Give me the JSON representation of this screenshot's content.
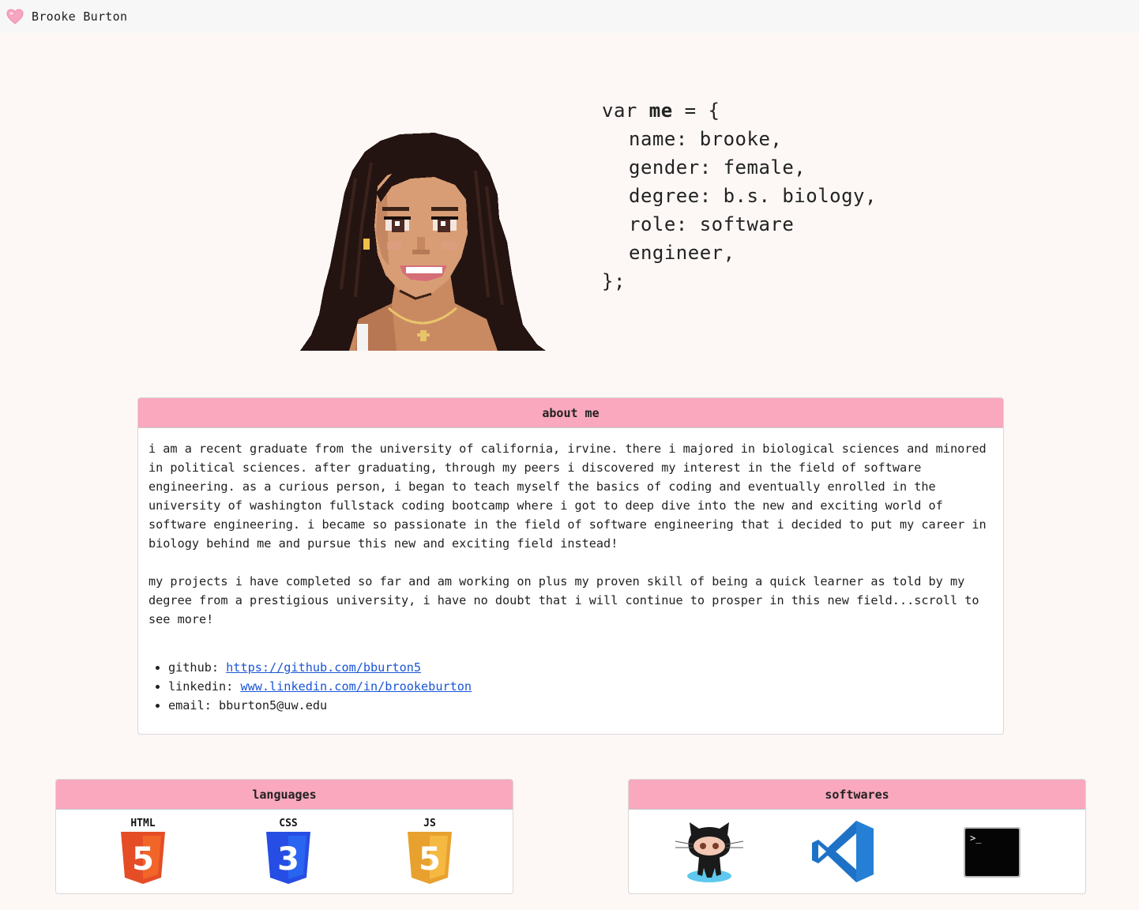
{
  "navbar": {
    "brand": "Brooke Burton",
    "logo_icon": "heart-icon"
  },
  "hero": {
    "avatar_icon": "pixel-portrait-avatar",
    "code": {
      "line1_prefix": "var ",
      "line1_var": "me",
      "line1_suffix": " = {",
      "name": "name: brooke,",
      "gender": "gender: female,",
      "degree": "degree: b.s. biology,",
      "role_line1": "role: software",
      "role_line2": "engineer,",
      "close": "};"
    }
  },
  "about": {
    "title": "about me",
    "paragraph1": "i am a recent graduate from the university of california, irvine. there i majored in biological sciences and minored in political sciences. after graduating, through my peers i discovered my interest in the field of software engineering. as a curious person, i began to teach myself the basics of coding and eventually enrolled in the university of washington fullstack coding bootcamp where i got to deep dive into the new and exciting world of software engineering. i became so passionate in the field of software engineering that i decided to put my career in biology behind me and pursue this new and exciting field instead!",
    "paragraph2": "my projects i have completed so far and am working on plus my proven skill of being a quick learner as told by my degree from a prestigious university, i have no doubt that i will continue to prosper in this new field...scroll to see more!",
    "links": {
      "github_label": "github: ",
      "github_url": "https://github.com/bburton5",
      "linkedin_label": "linkedin: ",
      "linkedin_url": "www.linkedin.com/in/brookeburton",
      "email_label": "email: ",
      "email_value": "bburton5@uw.edu"
    }
  },
  "languages": {
    "title": "languages",
    "items": [
      {
        "icon": "html5-icon",
        "text": "HTML",
        "glyph": "5",
        "color": "#e44d26"
      },
      {
        "icon": "css3-icon",
        "text": "CSS",
        "glyph": "3",
        "color": "#264de4"
      },
      {
        "icon": "js-icon",
        "text": "JS",
        "glyph": "5",
        "color": "#e8a12e"
      }
    ]
  },
  "softwares": {
    "title": "softwares",
    "items": [
      {
        "icon": "github-octocat-icon"
      },
      {
        "icon": "vscode-icon",
        "color": "#1e72c6"
      },
      {
        "icon": "terminal-icon",
        "glyph": ">_"
      }
    ]
  },
  "colors": {
    "accent_pink": "#f9a8be",
    "link_blue": "#1a55d6",
    "background": "#fdf8f6"
  }
}
